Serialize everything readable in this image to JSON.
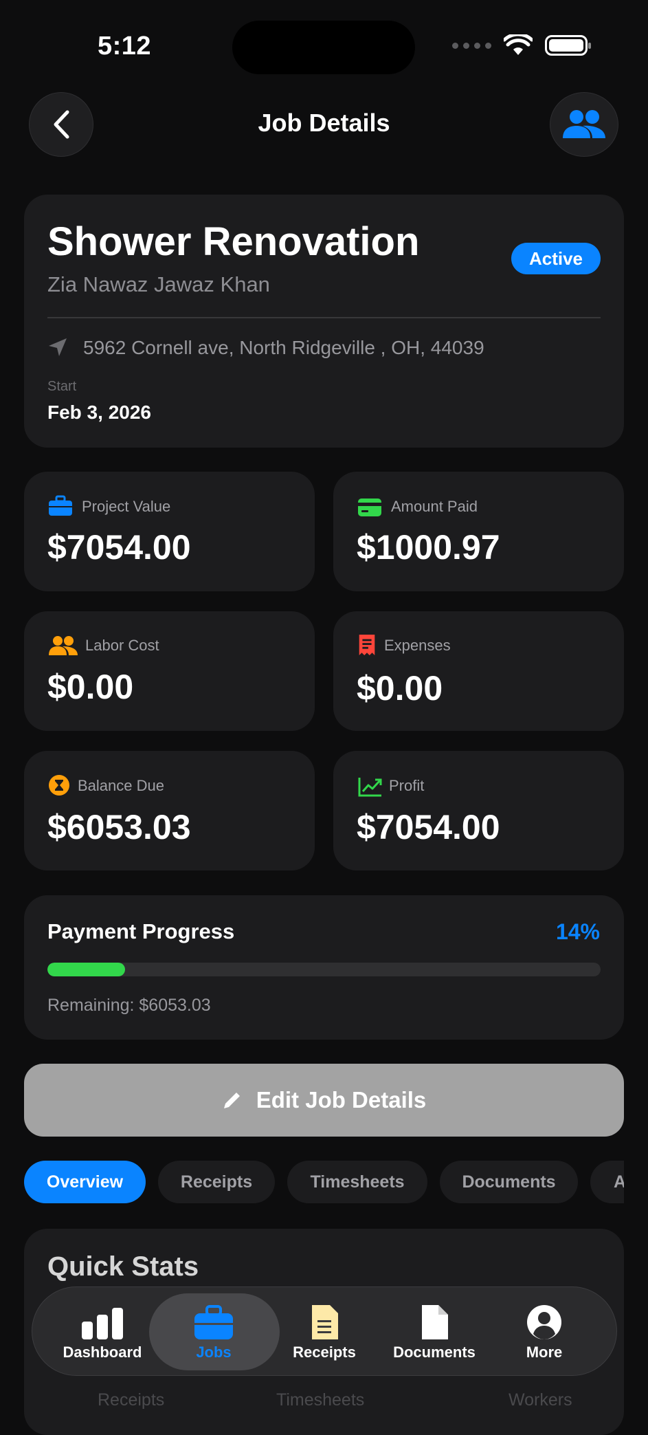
{
  "status_bar": {
    "time": "5:12"
  },
  "header": {
    "title": "Job Details"
  },
  "job": {
    "title": "Shower Renovation",
    "client": "Zia Nawaz Jawaz Khan",
    "status": "Active",
    "address": "5962 Cornell ave, North Ridgeville , OH, 44039",
    "start_label": "Start",
    "start_date": "Feb 3, 2026"
  },
  "stats": [
    {
      "label": "Project Value",
      "value": "$7054.00",
      "icon": "briefcase-icon",
      "color": "#0a84ff"
    },
    {
      "label": "Amount Paid",
      "value": "$1000.97",
      "icon": "credit-card-icon",
      "color": "#32d74b"
    },
    {
      "label": "Labor Cost",
      "value": "$0.00",
      "icon": "people-icon",
      "color": "#ff9f0a"
    },
    {
      "label": "Expenses",
      "value": "$0.00",
      "icon": "receipt-icon",
      "color": "#ff453a"
    },
    {
      "label": "Balance Due",
      "value": "$6053.03",
      "icon": "hourglass-icon",
      "color": "#ff9f0a"
    },
    {
      "label": "Profit",
      "value": "$7054.00",
      "icon": "trend-up-icon",
      "color": "#32d74b"
    }
  ],
  "payment": {
    "title": "Payment Progress",
    "percent_label": "14%",
    "progress_fraction": 0.14,
    "remaining": "Remaining: $6053.03"
  },
  "edit_button": {
    "label": "Edit Job Details"
  },
  "tabs": [
    "Overview",
    "Receipts",
    "Timesheets",
    "Documents",
    "A"
  ],
  "quick_stats": {
    "title": "Quick Stats",
    "ghost_labels": [
      "Receipts",
      "Timesheets",
      "Workers"
    ]
  },
  "tab_bar": [
    {
      "label": "Dashboard",
      "icon": "bar-chart-icon"
    },
    {
      "label": "Jobs",
      "icon": "briefcase-icon",
      "active": true
    },
    {
      "label": "Receipts",
      "icon": "receipt-doc-icon"
    },
    {
      "label": "Documents",
      "icon": "document-icon"
    },
    {
      "label": "More",
      "icon": "person-circle-icon"
    }
  ],
  "colors": {
    "accent": "#0a84ff",
    "success": "#32d74b",
    "warning": "#ff9f0a",
    "danger": "#ff453a",
    "card": "#1c1c1e"
  }
}
